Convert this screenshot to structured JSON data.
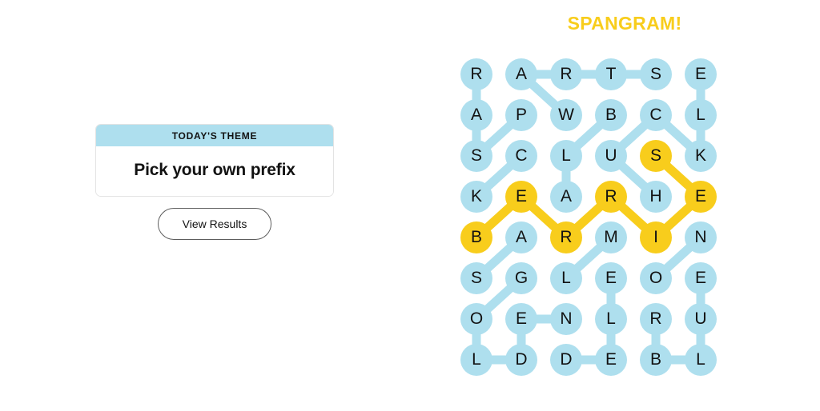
{
  "left": {
    "theme_card": {
      "header_label": "TODAY'S THEME",
      "theme_text": "Pick your own prefix"
    },
    "view_results_label": "View Results"
  },
  "right": {
    "banner_label": "SPANGRAM!",
    "colors": {
      "cell_blue": "#AEDFEE",
      "cell_yellow": "#F8CD1C",
      "letter": "#121212",
      "banner": "#F8CD1C"
    },
    "board": {
      "rows": 8,
      "cols": 6,
      "cell_size": 40,
      "col_step": 56,
      "row_step": 51,
      "letters": [
        [
          "R",
          "A",
          "R",
          "T",
          "S",
          "E"
        ],
        [
          "A",
          "P",
          "W",
          "B",
          "C",
          "L"
        ],
        [
          "S",
          "C",
          "L",
          "U",
          "S",
          "K"
        ],
        [
          "K",
          "E",
          "A",
          "R",
          "H",
          "E"
        ],
        [
          "B",
          "A",
          "R",
          "M",
          "I",
          "N"
        ],
        [
          "S",
          "G",
          "L",
          "E",
          "O",
          "E"
        ],
        [
          "O",
          "E",
          "N",
          "L",
          "R",
          "U"
        ],
        [
          "L",
          "D",
          "D",
          "E",
          "B",
          "L"
        ]
      ],
      "spangram_cells": [
        [
          2,
          4
        ],
        [
          3,
          1
        ],
        [
          3,
          3
        ],
        [
          3,
          5
        ],
        [
          4,
          0
        ],
        [
          4,
          2
        ],
        [
          4,
          4
        ]
      ],
      "spangram_word": "BERRIES",
      "spangram_path": [
        [
          4,
          0
        ],
        [
          3,
          1
        ],
        [
          4,
          2
        ],
        [
          3,
          3
        ],
        [
          4,
          4
        ],
        [
          3,
          5
        ],
        [
          2,
          4
        ]
      ],
      "blue_links": [
        [
          [
            0,
            0
          ],
          [
            1,
            0
          ]
        ],
        [
          [
            1,
            0
          ],
          [
            2,
            0
          ]
        ],
        [
          [
            0,
            1
          ],
          [
            0,
            2
          ]
        ],
        [
          [
            0,
            2
          ],
          [
            0,
            3
          ]
        ],
        [
          [
            0,
            3
          ],
          [
            0,
            4
          ]
        ],
        [
          [
            0,
            1
          ],
          [
            1,
            2
          ]
        ],
        [
          [
            1,
            1
          ],
          [
            2,
            0
          ]
        ],
        [
          [
            1,
            3
          ],
          [
            2,
            2
          ]
        ],
        [
          [
            1,
            4
          ],
          [
            2,
            3
          ]
        ],
        [
          [
            1,
            4
          ],
          [
            2,
            5
          ]
        ],
        [
          [
            0,
            5
          ],
          [
            1,
            5
          ]
        ],
        [
          [
            1,
            5
          ],
          [
            2,
            5
          ]
        ],
        [
          [
            2,
            1
          ],
          [
            3,
            0
          ]
        ],
        [
          [
            2,
            2
          ],
          [
            3,
            2
          ]
        ],
        [
          [
            2,
            3
          ],
          [
            3,
            4
          ]
        ],
        [
          [
            4,
            1
          ],
          [
            5,
            0
          ]
        ],
        [
          [
            4,
            3
          ],
          [
            5,
            2
          ]
        ],
        [
          [
            4,
            5
          ],
          [
            5,
            4
          ]
        ],
        [
          [
            5,
            1
          ],
          [
            6,
            0
          ]
        ],
        [
          [
            5,
            3
          ],
          [
            6,
            3
          ]
        ],
        [
          [
            5,
            5
          ],
          [
            6,
            5
          ]
        ],
        [
          [
            6,
            1
          ],
          [
            6,
            2
          ]
        ],
        [
          [
            6,
            0
          ],
          [
            7,
            0
          ]
        ],
        [
          [
            6,
            1
          ],
          [
            7,
            1
          ]
        ],
        [
          [
            6,
            3
          ],
          [
            7,
            3
          ]
        ],
        [
          [
            6,
            4
          ],
          [
            7,
            4
          ]
        ],
        [
          [
            6,
            5
          ],
          [
            7,
            5
          ]
        ],
        [
          [
            7,
            0
          ],
          [
            7,
            1
          ]
        ],
        [
          [
            7,
            2
          ],
          [
            7,
            3
          ]
        ],
        [
          [
            7,
            4
          ],
          [
            7,
            5
          ]
        ]
      ]
    }
  }
}
